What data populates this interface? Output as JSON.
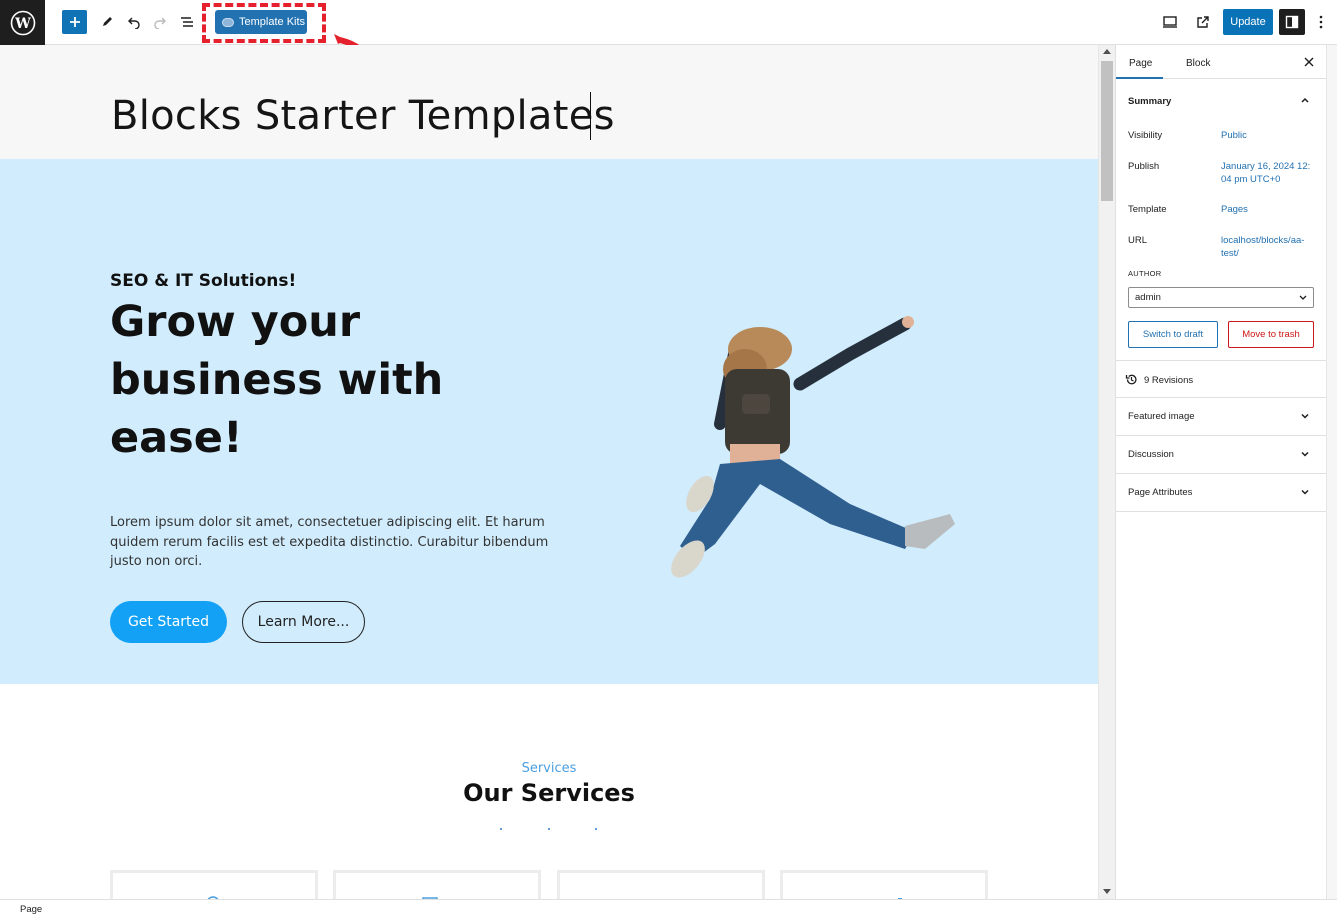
{
  "toolbar": {
    "logo_icon": "wordpress-logo-icon",
    "add_icon": "plus-icon",
    "tools_icon": "pencil-icon",
    "undo_icon": "undo-icon",
    "redo_icon": "redo-icon",
    "outline_icon": "list-view-icon",
    "template_kits_label": "Template Kits",
    "view_icon": "desktop-preview-icon",
    "external_icon": "external-link-icon",
    "update_label": "Update",
    "settings_icon": "sidebar-settings-icon",
    "options_icon": "more-vertical-icon",
    "accent": "#2271b1",
    "highlight_color": "#e4212c"
  },
  "editor": {
    "page_title": "Blocks Starter Templates",
    "hero": {
      "eyebrow": "SEO & IT Solutions!",
      "heading": "Grow your business with ease!",
      "paragraph": "Lorem ipsum dolor sit amet, consectetuer adipiscing elit. Et harum quidem rerum facilis est et expedita distinctio. Curabitur bibendum justo non orci.",
      "primary_button": "Get Started",
      "secondary_button": "Learn More...",
      "background": "#d1edfd",
      "image_alt": "jumping-person-image"
    },
    "services": {
      "eyebrow": "Services",
      "title": "Our Services"
    }
  },
  "sidebar": {
    "tabs": [
      "Page",
      "Block"
    ],
    "active_tab": "Page",
    "summary": {
      "title": "Summary",
      "rows": [
        {
          "label": "Visibility",
          "value": "Public"
        },
        {
          "label": "Publish",
          "value": "January 16, 2024 12:04 pm UTC+0"
        },
        {
          "label": "Template",
          "value": "Pages"
        },
        {
          "label": "URL",
          "value": "localhost/blocks/aa-test/"
        }
      ],
      "author_label": "AUTHOR",
      "author_value": "admin",
      "switch_draft": "Switch to draft",
      "move_trash": "Move to trash"
    },
    "revisions": "9 Revisions",
    "panels": [
      "Featured image",
      "Discussion",
      "Page Attributes"
    ]
  },
  "footer": {
    "breadcrumb": "Page"
  }
}
